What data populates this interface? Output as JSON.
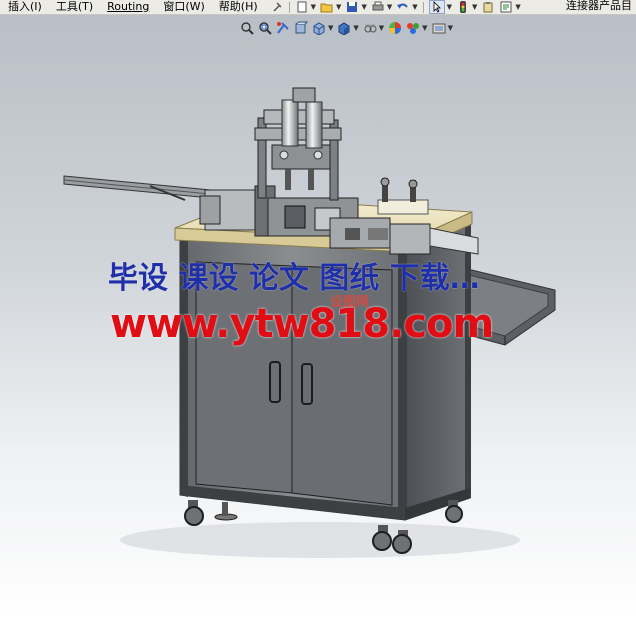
{
  "menu": {
    "items": [
      {
        "label": "插入(I)",
        "name": "menu-insert"
      },
      {
        "label": "工具(T)",
        "name": "menu-tools"
      },
      {
        "label": "Routing",
        "name": "menu-routing"
      },
      {
        "label": "窗口(W)",
        "name": "menu-window"
      },
      {
        "label": "帮助(H)",
        "name": "menu-help"
      }
    ],
    "assembly_label": "连接器产品目"
  },
  "watermark": {
    "line1": "毕设 课设 论文 图纸 下载…",
    "line2": "www.ytw818.com",
    "small": "设图网"
  },
  "colors": {
    "watermark_blue": "#1f2fa8",
    "watermark_red": "#e10d14",
    "cabinet": "#7a7d80",
    "tabletop": "#efe6c2",
    "frame": "#4a4e52"
  },
  "icons": {
    "top_toolbar": [
      "pin-icon",
      "new-document-icon",
      "open-folder-icon",
      "save-icon",
      "print-icon",
      "undo-icon",
      "select-cursor-icon",
      "traffic-light-icon",
      "clipboard-icon",
      "options-icon"
    ],
    "view_toolbar": [
      "zoom-to-fit-icon",
      "zoom-to-area-icon",
      "previous-view-icon",
      "section-view-icon",
      "view-orientation-icon",
      "display-style-icon",
      "hide-show-items-icon",
      "appearance-icon",
      "scene-icon",
      "view-settings-icon"
    ]
  }
}
